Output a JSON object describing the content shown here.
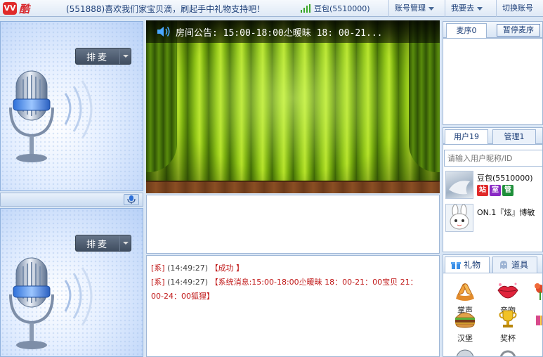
{
  "app": {
    "logo_badge": "VV",
    "logo_text": "酷",
    "marquee": "(551888)喜欢我们家宝贝滴，刷起手中礼物支持吧！",
    "current_user": "豆包(5510000)",
    "menu": {
      "account": "账号管理",
      "want_to_go": "我要去",
      "switch_account": "切换账号"
    }
  },
  "mic_slots": {
    "slot1_btn": "排麦",
    "slot2_btn": "排麦"
  },
  "stage": {
    "announcement": "房间公告: 15:00-18:00尐暖昧 18: 00-21..."
  },
  "chat": {
    "messages": [
      {
        "prefix": "[系]",
        "time": "(14:49:27)",
        "text": "【成功 】"
      },
      {
        "prefix": "[系]",
        "time": "(14:49:27)",
        "text": "【系统消息:15:00-18:00尐暖昧 18：00-21：00宝贝 21："
      },
      {
        "prefix": "",
        "time": "",
        "text": "00-24：00狐狸】"
      }
    ]
  },
  "right": {
    "queue_tab": "麦序0",
    "pause_btn": "暂停麦序",
    "users_tab": "用户19",
    "admins_tab": "管理1",
    "search_placeholder": "请输入用户昵称/ID",
    "users": [
      {
        "name": "豆包(5510000)",
        "badges": [
          "站",
          "室",
          "管"
        ]
      },
      {
        "name": "ОN.1『炫』博敏"
      }
    ],
    "gift_tab": "礼物",
    "prop_tab": "道具",
    "gifts": [
      {
        "name": "掌声",
        "icon": "clap-icon"
      },
      {
        "name": "亲吻",
        "icon": "lips-icon"
      },
      {
        "name": "汉堡",
        "icon": "burger-icon"
      },
      {
        "name": "奖杯",
        "icon": "trophy-icon"
      }
    ]
  },
  "colors": {
    "accent": "#1d3f78",
    "brand_red": "#d8262b",
    "system_msg": "#c01818",
    "stage_green": "#8fc416"
  }
}
